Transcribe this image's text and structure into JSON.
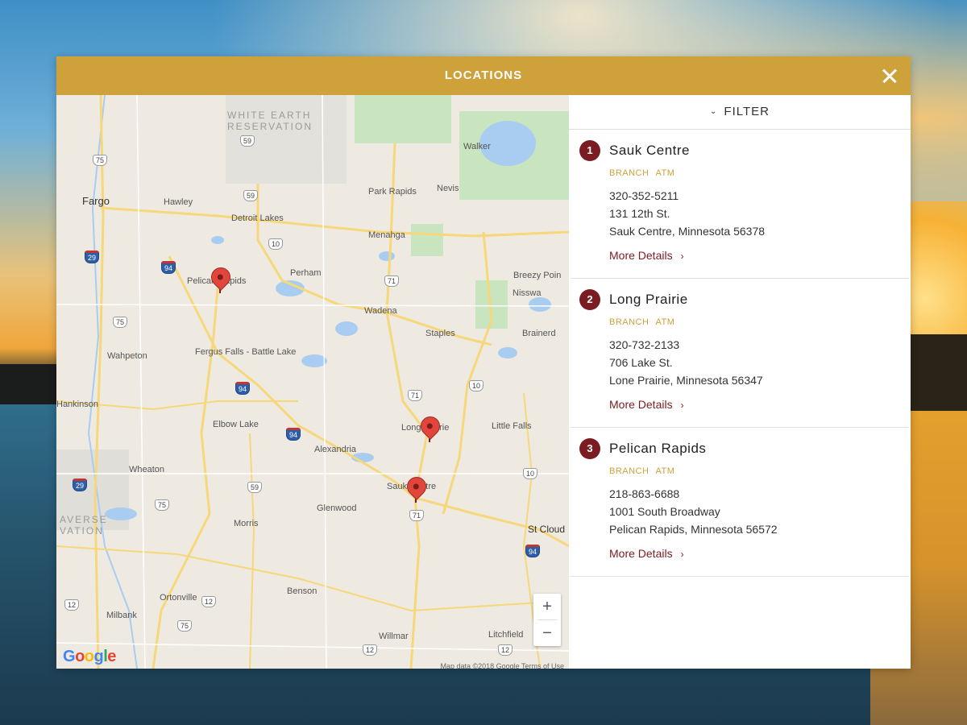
{
  "modal": {
    "title": "LOCATIONS"
  },
  "filter": {
    "label": "FILTER"
  },
  "locations": [
    {
      "num": "1",
      "name": "Sauk Centre",
      "tags": [
        "BRANCH",
        "ATM"
      ],
      "phone": "320-352-5211",
      "address1": "131 12th St.",
      "address2": "Sauk Centre, Minnesota 56378",
      "more": "More Details"
    },
    {
      "num": "2",
      "name": "Long Prairie",
      "tags": [
        "BRANCH",
        "ATM"
      ],
      "phone": "320-732-2133",
      "address1": "706 Lake St.",
      "address2": "Lone Prairie, Minnesota 56347",
      "more": "More Details"
    },
    {
      "num": "3",
      "name": "Pelican Rapids",
      "tags": [
        "BRANCH",
        "ATM"
      ],
      "phone": "218-863-6688",
      "address1": "1001 South Broadway",
      "address2": "Pelican Rapids, Minnesota 56572",
      "more": "More Details"
    }
  ],
  "map": {
    "places": {
      "fargo": "Fargo",
      "hawley": "Hawley",
      "detroit_lakes": "Detroit Lakes",
      "park_rapids": "Park Rapids",
      "nevis": "Nevis",
      "walker": "Walker",
      "menahga": "Menahga",
      "pelican_rapids": "Pelican Rapids",
      "perham": "Perham",
      "breezy_point": "Breezy Poin",
      "nisswa": "Nisswa",
      "wadena": "Wadena",
      "staples": "Staples",
      "brainerd": "Brainerd",
      "wahpeton": "Wahpeton",
      "fergus_falls": "Fergus Falls",
      "battle_lake": "Battle Lake",
      "hankinson": "Hankinson",
      "elbow_lake": "Elbow Lake",
      "long_prairie": "Long Prairie",
      "little_falls": "Little Falls",
      "alexandria": "Alexandria",
      "wheaton": "Wheaton",
      "sauk_centre": "Sauk Centre",
      "glenwood": "Glenwood",
      "morris": "Morris",
      "st_cloud": "St Cloud",
      "ortonville": "Ortonville",
      "benson": "Benson",
      "milbank": "Milbank",
      "willmar": "Willmar",
      "litchfield": "Litchfield"
    },
    "reservation_1": "WHITE EARTH",
    "reservation_2": "RESERVATION",
    "reservation_3": "AVERSE",
    "reservation_4": "VATION",
    "shields": [
      "75",
      "59",
      "59",
      "10",
      "71",
      "94",
      "29",
      "75",
      "94",
      "10",
      "71",
      "94",
      "29",
      "59",
      "71",
      "10",
      "75",
      "94",
      "12",
      "12",
      "75",
      "12",
      "12"
    ],
    "zoom_in": "+",
    "zoom_out": "−",
    "google": "Google",
    "attribution": "Map data ©2018 Google   Terms of Use"
  },
  "colors": {
    "header": "#cea13b",
    "accent": "#7b1c22",
    "tag": "#cea13b"
  }
}
